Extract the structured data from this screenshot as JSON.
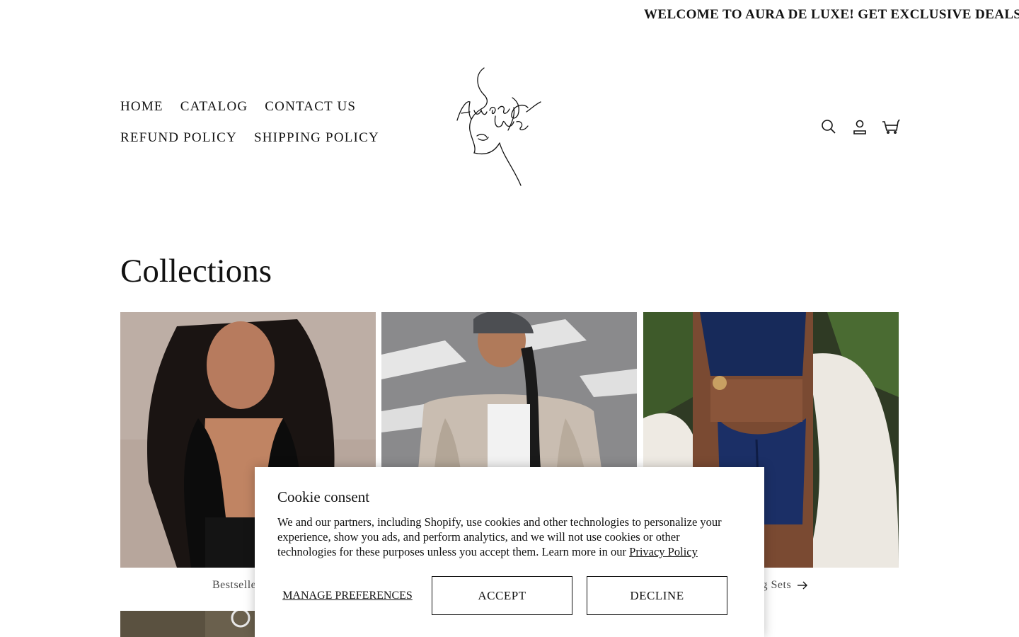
{
  "announcement": {
    "text": "WELCOME TO AURA DE LUXE! GET EXCLUSIVE DEALS"
  },
  "nav": {
    "items": [
      {
        "label": "HOME"
      },
      {
        "label": "CATALOG"
      },
      {
        "label": "CONTACT US"
      },
      {
        "label": "REFUND POLICY"
      },
      {
        "label": "SHIPPING POLICY"
      }
    ]
  },
  "logo": {
    "text": "Aura De Luxe"
  },
  "header_icons": [
    "search-icon",
    "account-icon",
    "cart-icon"
  ],
  "main": {
    "title": "Collections",
    "collections": [
      {
        "label": "Bestselle"
      },
      {
        "label": ""
      },
      {
        "label": "ng Sets"
      }
    ]
  },
  "cookie": {
    "title": "Cookie consent",
    "body": "We and our partners, including Shopify, use cookies and other technologies to personalize your experience, show you ads, and perform analytics, and we will not use cookies or other technologies for these purposes unless you accept them. Learn more in our ",
    "link": "Privacy Policy",
    "manage_label": "MANAGE PREFERENCES",
    "accept_label": "ACCEPT",
    "decline_label": "DECLINE"
  }
}
